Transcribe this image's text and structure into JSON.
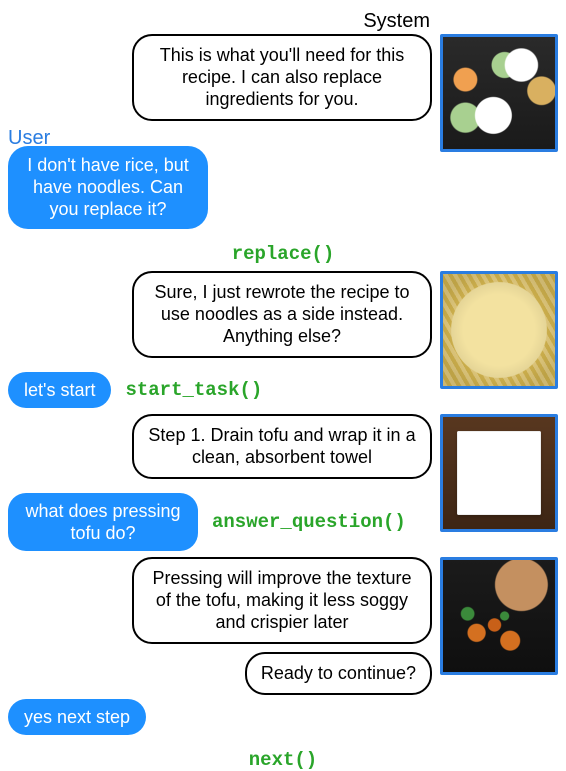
{
  "labels": {
    "system": "System",
    "user": "User"
  },
  "actions": {
    "replace": "replace()",
    "start_task": "start_task()",
    "answer_question": "answer_question()",
    "next": "next()"
  },
  "turns": {
    "sys_intro": "This is what you'll need for this recipe. I can also replace ingredients for you.",
    "user_replace": "I don't have rice, but have noodles. Can you replace it?",
    "sys_replace_ack": "Sure, I just rewrote the recipe to use noodles as a side instead. Anything else?",
    "user_start": "let's start",
    "sys_step1": "Step 1. Drain tofu and wrap it in a clean, absorbent towel",
    "user_question": "what does pressing tofu do?",
    "sys_answer": "Pressing will improve the texture of the tofu, making it less soggy and crispier later",
    "sys_ready": "Ready to continue?",
    "user_next": "yes next step"
  },
  "photos": {
    "p1": "recipe-ingredients-photo",
    "p2": "noodles-photo",
    "p3": "tofu-wrapped-towel-photo",
    "p4": "cooked-tofu-pan-photo"
  }
}
